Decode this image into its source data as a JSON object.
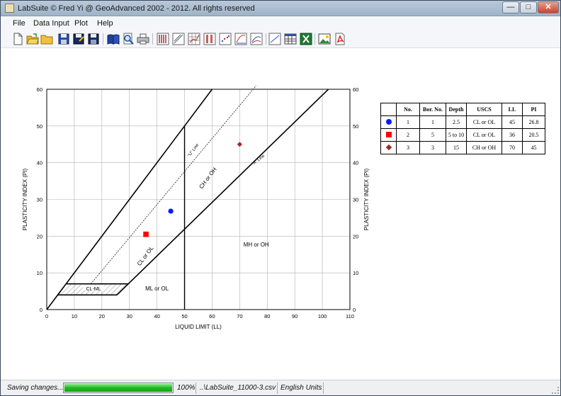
{
  "window": {
    "title": "LabSuite © Fred Yi @ GeoAdvanced 2002 - 2012. All rights reserved",
    "controls": [
      "—",
      "□",
      "✕"
    ]
  },
  "menu": [
    "File",
    "Data Input",
    "Plot",
    "Help"
  ],
  "toolbar": {
    "icons": [
      "new-file-icon",
      "open-folder-icon",
      "folder-icon",
      "save-icon",
      "save-as-icon",
      "save-all-icon",
      "book-icon",
      "preview-icon",
      "print-icon",
      "bar-plot-icon",
      "line-plot-icon",
      "grid-plot-icon",
      "column-plot-icon",
      "scatter-plot-icon",
      "curve-plot-icon",
      "multi-curve-icon",
      "trend-plot-icon",
      "table-icon",
      "excel-icon",
      "image-icon",
      "pdf-icon"
    ]
  },
  "status": {
    "message": "Saving changes...",
    "progress": 1.0,
    "zoom": "100%",
    "file": "..\\LabSuite_11000-3.csv",
    "units": "English Units"
  },
  "colors": {
    "accent_green": "#1fb81f",
    "point_blue": "#0a1aff",
    "point_red": "#ff0000",
    "point_brown": "#a52a2a"
  },
  "chart_data": {
    "type": "scatter",
    "title": "",
    "xlabel": "LIQUID LIMIT (LL)",
    "ylabel": "PLASTICITY INDEX (PI)",
    "ylabel_right": "PLASTICITY INDEX (PI)",
    "xlim": [
      0,
      110
    ],
    "ylim": [
      0,
      60
    ],
    "xticks": [
      0,
      10,
      20,
      30,
      40,
      50,
      60,
      70,
      80,
      90,
      100,
      110
    ],
    "yticks": [
      0,
      10,
      20,
      30,
      40,
      50,
      60
    ],
    "grid": true,
    "lines": [
      {
        "name": "\"A\" Line",
        "x": [
          25.48,
          102.19
        ],
        "y": [
          4,
          60
        ]
      },
      {
        "name": "\"U\" Line",
        "x": [
          16,
          76
        ],
        "y": [
          7,
          61
        ]
      }
    ],
    "regions": [
      "CL-ML",
      "ML or OL",
      "CL or OL",
      "CH or OH",
      "MH or OH"
    ],
    "points": [
      {
        "symbol": "circle",
        "ll": 45,
        "pi": 26.8
      },
      {
        "symbol": "square",
        "ll": 36,
        "pi": 20.5
      },
      {
        "symbol": "diamond",
        "ll": 70,
        "pi": 45
      }
    ],
    "table": {
      "headers": [
        "",
        "No.",
        "Bor. No.",
        "Depth",
        "USCS",
        "LL",
        "PI"
      ],
      "rows": [
        {
          "symbol": "circle",
          "no": "1",
          "bor": "1",
          "depth": "2.5",
          "uscs": "CL or OL",
          "ll": "45",
          "pi": "26.8"
        },
        {
          "symbol": "square",
          "no": "2",
          "bor": "5",
          "depth": "5 to 10",
          "uscs": "CL or OL",
          "ll": "36",
          "pi": "20.5"
        },
        {
          "symbol": "diamond",
          "no": "3",
          "bor": "3",
          "depth": "15",
          "uscs": "CH or OH",
          "ll": "70",
          "pi": "45"
        }
      ]
    }
  }
}
